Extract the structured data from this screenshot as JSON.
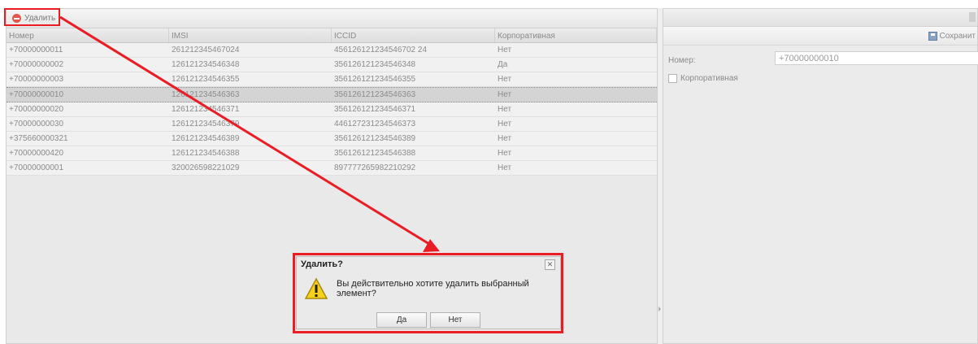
{
  "toolbar": {
    "delete_label": "Удалить"
  },
  "grid": {
    "columns": [
      "Номер",
      "IMSI",
      "ICCID",
      "Корпоративная"
    ],
    "rows": [
      [
        "+70000000011",
        "261212345467024",
        "456126121234546702 24",
        "Нет"
      ],
      [
        "+70000000002",
        "126121234546348",
        "356126121234546348",
        "Да"
      ],
      [
        "+70000000003",
        "126121234546355",
        "356126121234546355",
        "Нет"
      ],
      [
        "+70000000010",
        "126121234546363",
        "356126121234546363",
        "Нет"
      ],
      [
        "+70000000020",
        "126121234546371",
        "356126121234546371",
        "Нет"
      ],
      [
        "+70000000030",
        "126121234546379",
        "446127231234546373",
        "Нет"
      ],
      [
        "+375660000321",
        "126121234546389",
        "356126121234546389",
        "Нет"
      ],
      [
        "+70000000420",
        "126121234546388",
        "356126121234546388",
        "Нет"
      ],
      [
        "+70000000001",
        "320026598221029",
        "897777265982210292",
        "Нет"
      ]
    ],
    "selected_row": 3
  },
  "form": {
    "save_label": "Сохранит",
    "number_label": "Номер:",
    "number_value": "+70000000010",
    "corporate_label": "Корпоративная",
    "corporate_checked": false
  },
  "dialog": {
    "title": "Удалить?",
    "message": "Вы действительно хотите удалить выбранный элемент?",
    "yes_label": "Да",
    "no_label": "Нет",
    "icon": "warning-icon"
  },
  "colors": {
    "annotation": "#ea1c24",
    "delete": "#e2574c"
  }
}
